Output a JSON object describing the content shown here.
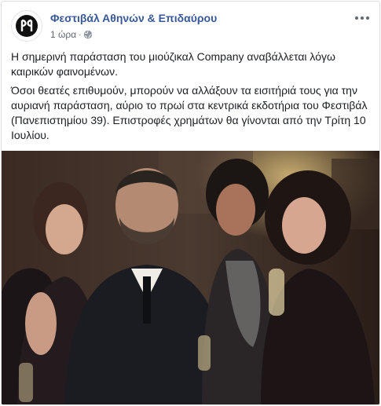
{
  "post": {
    "page_name": "Φεστιβάλ Αθηνών & Επιδαύρου",
    "timestamp": "1 ώρα",
    "separator": "·",
    "audience_icon": "globe-icon",
    "menu_icon": "more-options-icon",
    "paragraphs": [
      "Η σημερινή παράσταση του μιούζικαλ Company αναβάλλεται λόγω καιρικών φαινομένων.",
      "Όσοι θεατές επιθυμούν, μπορούν να αλλάξουν τα εισιτήριά τους για την αυριανή παράσταση, αύριο το πρωί στα κεντρικά εκδοτήρια του Φεστιβάλ (Πανεπιστημίου 39). Επιστροφές χρημάτων θα γίνονται από την Τρίτη 10 Ιουλίου."
    ]
  },
  "colors": {
    "link": "#385898",
    "meta": "#616770",
    "text": "#1c1e21",
    "border": "#dddfe2"
  }
}
